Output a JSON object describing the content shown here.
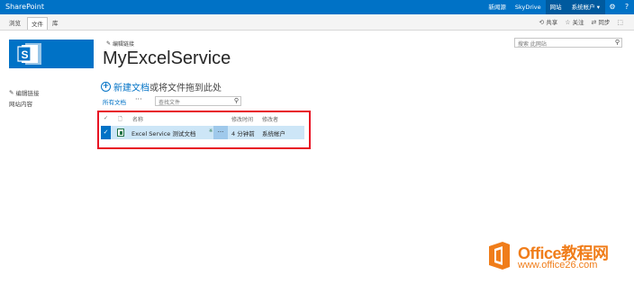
{
  "suitebar": {
    "brand": "SharePoint",
    "links": [
      "新闻源",
      "SkyDrive",
      "网站"
    ],
    "active_link": "网站",
    "user": "系统帐户 ▾",
    "icons": [
      "gear-icon",
      "help-icon"
    ]
  },
  "ribbon": {
    "tabs": [
      "浏览",
      "文件",
      "库"
    ],
    "share": "共享",
    "follow": "关注",
    "sync": "同步"
  },
  "header": {
    "edit_links": "编辑链接",
    "site_title": "MyExcelService",
    "search_placeholder": "搜索 此网站"
  },
  "leftnav": {
    "edit_links": "编辑链接",
    "site_contents": "网站内容"
  },
  "library": {
    "new_doc_link": "新建文档",
    "new_doc_rest": "或将文件拖到此处",
    "view_all": "所有文档",
    "view_more": "···",
    "find_placeholder": "查找文件",
    "columns": {
      "name": "名称",
      "modified": "修改时间",
      "modified_by": "修改者"
    },
    "rows": [
      {
        "name": "Excel Service 测试文档",
        "new_flag": "※",
        "ellipsis": "···",
        "modified": "4 分钟前",
        "modified_by": "系统帐户"
      }
    ]
  },
  "watermark": {
    "brand": "Office教程网",
    "url": "www.office26.com"
  },
  "colors": {
    "suitebar": "#0072c6",
    "highlight": "#e81123",
    "selected_row": "#cde6f7",
    "watermark": "#f07d1a"
  }
}
